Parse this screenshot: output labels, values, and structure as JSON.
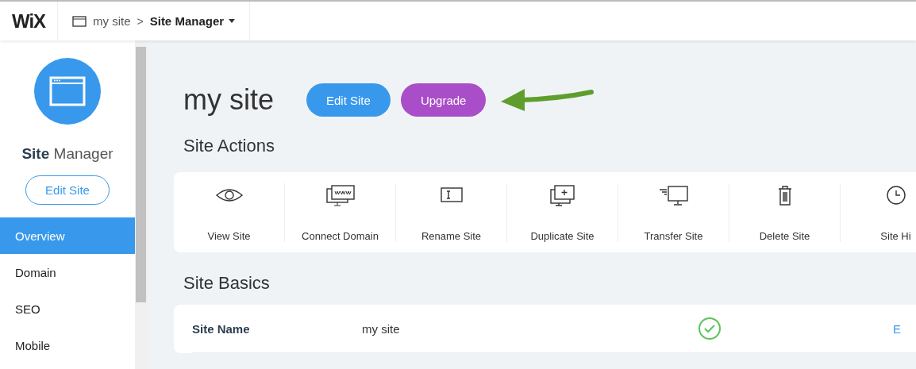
{
  "header": {
    "logo": "WiX",
    "site": "my site",
    "separator": ">",
    "page": "Site Manager"
  },
  "sidebar": {
    "title": "**Site** Manager",
    "edit_button": "Edit Site",
    "items": [
      {
        "label": "Overview",
        "selected": true
      },
      {
        "label": "Domain",
        "selected": false
      },
      {
        "label": "SEO",
        "selected": false
      },
      {
        "label": "Mobile",
        "selected": false
      }
    ]
  },
  "main": {
    "title": "my site",
    "buttons": [
      {
        "label": "Edit Site",
        "kind": "primary"
      },
      {
        "label": "Upgrade",
        "kind": "upgrade"
      }
    ],
    "site_actions": {
      "heading": "Site Actions",
      "actions": [
        {
          "label": "View Site",
          "kind": "eye"
        },
        {
          "label": "Connect Domain",
          "kind": "www"
        },
        {
          "label": "Rename Site",
          "kind": "rename"
        },
        {
          "label": "Duplicate Site",
          "kind": "duplicate"
        },
        {
          "label": "Transfer Site",
          "kind": "transfer"
        },
        {
          "label": "Delete Site",
          "kind": "trash"
        },
        {
          "label": "Site Hi",
          "kind": "clock"
        }
      ]
    },
    "site_basics": {
      "heading": "Site Basics",
      "rows": [
        {
          "label": "Site Name",
          "value": "my site",
          "verified": true,
          "action": "E"
        }
      ]
    }
  }
}
